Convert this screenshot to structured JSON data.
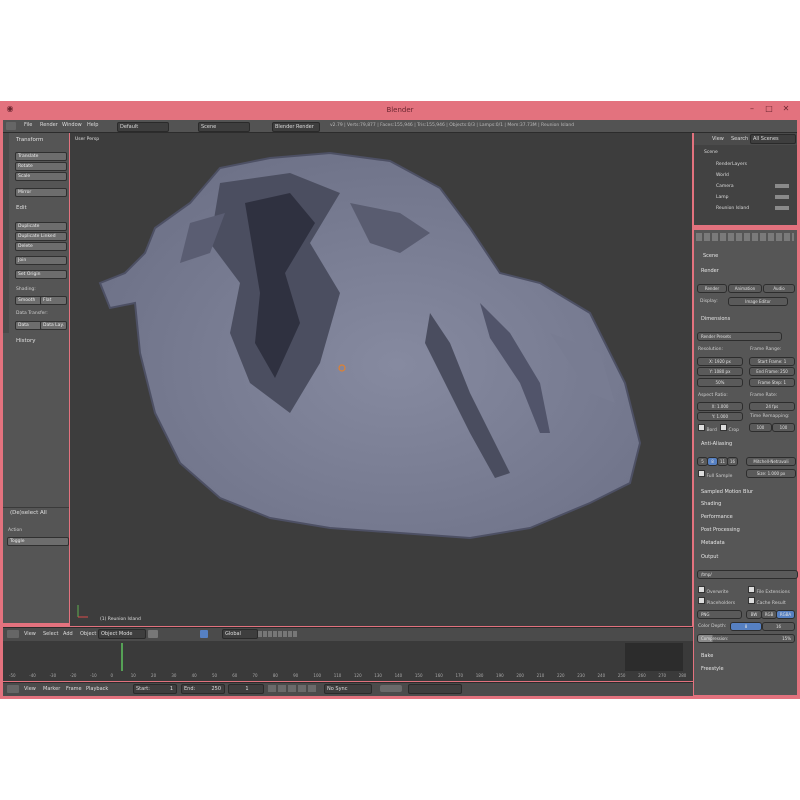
{
  "window": {
    "title": "Blender"
  },
  "menu": {
    "items": [
      "File",
      "Render",
      "Window",
      "Help"
    ],
    "layout": "Default",
    "scene": "Scene",
    "engine": "Blender Render",
    "stats": "v2.79 | Verts:79,877 | Faces:155,946 | Tris:155,946 | Objects:0/3 | Lamps:0/1 | Mem:37.73M | Reunion Island"
  },
  "toolshelf": {
    "transform_header": "Transform",
    "transform_buttons": [
      "Translate",
      "Rotate",
      "Scale",
      "Mirror"
    ],
    "edit_header": "Edit",
    "edit_buttons": [
      "Duplicate",
      "Duplicate Linked",
      "Delete",
      "Join"
    ],
    "set_origin": "Set Origin",
    "shading_label": "Shading:",
    "smooth": "Smooth",
    "flat": "Flat",
    "data_transfer_label": "Data Transfer:",
    "data": "Data",
    "data_layout": "Data Lay.",
    "history_header": "History",
    "operator_header": "(De)select All",
    "action_label": "Action",
    "action_value": "Toggle"
  },
  "viewport": {
    "view_label": "User Persp",
    "object_label": "(1) Reunion Island"
  },
  "viewport_header": {
    "items": [
      "View",
      "Select",
      "Add",
      "Object"
    ],
    "mode": "Object Mode",
    "orientation": "Global"
  },
  "timeline": {
    "ticks": [
      "-50",
      "-40",
      "-30",
      "-20",
      "-10",
      "0",
      "10",
      "20",
      "30",
      "40",
      "50",
      "60",
      "70",
      "80",
      "90",
      "100",
      "110",
      "120",
      "130",
      "140",
      "150",
      "160",
      "170",
      "180",
      "190",
      "200",
      "210",
      "220",
      "230",
      "240",
      "250",
      "260",
      "270",
      "280"
    ],
    "header_items": [
      "View",
      "Marker",
      "Frame",
      "Playback"
    ],
    "start_label": "Start:",
    "start": "1",
    "end_label": "End:",
    "end": "250",
    "current": "1",
    "sync": "No Sync"
  },
  "outliner": {
    "tabs": [
      "View",
      "Search",
      "All Scenes"
    ],
    "items": [
      "Scene",
      "RenderLayers",
      "World",
      "Camera",
      "Lamp",
      "Reunion Island"
    ]
  },
  "properties": {
    "scene_label": "Scene",
    "render_header": "Render",
    "render_buttons": [
      "Render",
      "Animation",
      "Audio"
    ],
    "display_label": "Display:",
    "display_value": "Image Editor",
    "dimensions_header": "Dimensions",
    "presets": "Render Presets",
    "resolution_label": "Resolution:",
    "res_x": "X: 1920 px",
    "res_y": "Y: 1080 px",
    "res_pct": "50%",
    "frame_range_label": "Frame Range:",
    "start_frame": "Start Frame: 1",
    "end_frame": "End Frame: 250",
    "frame_step": "Frame Step: 1",
    "aspect_label": "Aspect Ratio:",
    "asp_x": "X: 1.000",
    "asp_y": "Y: 1.000",
    "frame_rate_label": "Frame Rate:",
    "fps": "24 fps",
    "time_remap": "Time Remapping:",
    "remap_old": "100",
    "remap_new": "100",
    "border": "Bord",
    "crop": "Crop",
    "aa_header": "Anti-Aliasing",
    "aa_samples": [
      "5",
      "8",
      "11",
      "16"
    ],
    "aa_filter": "Mitchell-Netravali",
    "full_sample": "Full Sample",
    "filter_size": "Size: 1.000 px",
    "collapsed": [
      "Sampled Motion Blur",
      "Shading",
      "Performance",
      "Post Processing",
      "Metadata"
    ],
    "output_header": "Output",
    "output_path": "/tmp/",
    "overwrite": "Overwrite",
    "file_ext": "File Extensions",
    "placeholders": "Placeholders",
    "cache": "Cache Result",
    "format": "PNG",
    "bw": "BW",
    "rgb": "RGB",
    "rgba": "RGBA",
    "color_depth_label": "Color Depth:",
    "depth_8": "8",
    "depth_16": "16",
    "compression": "Compression:",
    "compression_value": "15%",
    "bake": "Bake",
    "freestyle": "Freestyle"
  },
  "colors": {
    "window_frame": "#e3727e",
    "panel": "#555555",
    "viewport": "#3d3d3d",
    "terrain": "#7d8196",
    "accent": "#5680c2"
  }
}
